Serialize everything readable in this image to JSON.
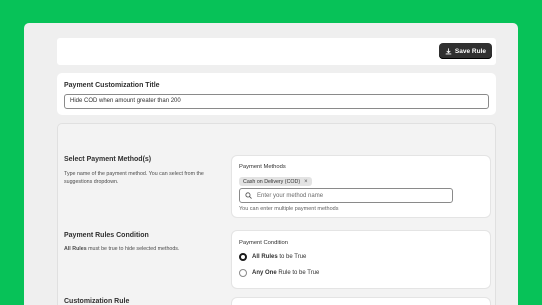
{
  "toolbar": {
    "save_label": "Save Rule"
  },
  "title_card": {
    "title": "Payment Customization Title",
    "input_value": "Hide COD when amount greater than 200"
  },
  "payment_methods": {
    "section_title": "Select Payment Method(s)",
    "section_desc": "Type name of the payment method. You can select from the suggestions dropdown.",
    "label": "Payment Methods",
    "tags": [
      "Cash on Delivery (COD)"
    ],
    "placeholder": "Enter your method name",
    "help_text": "You can enter multiple payment methods"
  },
  "rules_condition": {
    "section_title": "Payment Rules Condition",
    "desc_bold": "All Rules",
    "desc_rest": " must be true to hide selected methods.",
    "label": "Payment Condition",
    "options": [
      {
        "bold": "All Rules",
        "rest": " to be True",
        "selected": true
      },
      {
        "bold": "Any One",
        "rest": " Rule to be True",
        "selected": false
      }
    ]
  },
  "customization_rule": {
    "section_title": "Customization Rule"
  }
}
